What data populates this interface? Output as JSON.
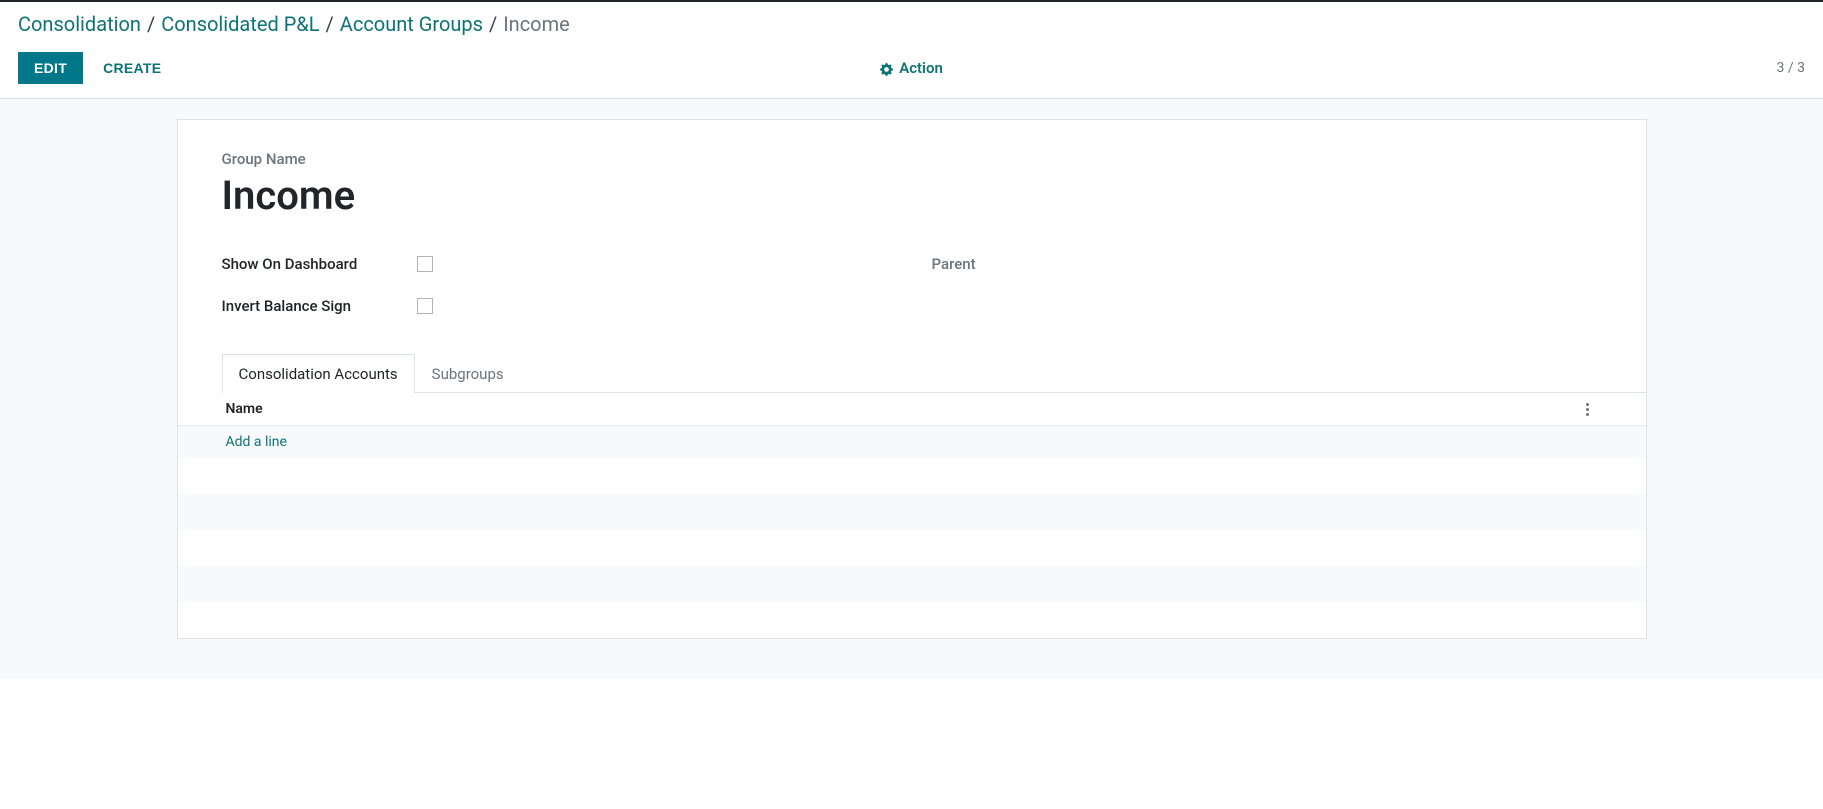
{
  "breadcrumb": {
    "items": [
      {
        "label": "Consolidation"
      },
      {
        "label": "Consolidated P&L"
      },
      {
        "label": "Account Groups"
      }
    ],
    "current": "Income",
    "separator": "/"
  },
  "controls": {
    "edit_label": "EDIT",
    "create_label": "CREATE",
    "action_label": "Action",
    "pager": "3 / 3"
  },
  "form": {
    "group_name_label": "Group Name",
    "group_name_value": "Income",
    "fields": {
      "show_on_dashboard": {
        "label": "Show On Dashboard",
        "checked": false
      },
      "invert_balance_sign": {
        "label": "Invert Balance Sign",
        "checked": false
      },
      "parent": {
        "label": "Parent",
        "value": ""
      }
    }
  },
  "tabs": [
    {
      "label": "Consolidation Accounts",
      "active": true
    },
    {
      "label": "Subgroups",
      "active": false
    }
  ],
  "table": {
    "columns": {
      "name": "Name"
    },
    "add_line_label": "Add a line"
  }
}
